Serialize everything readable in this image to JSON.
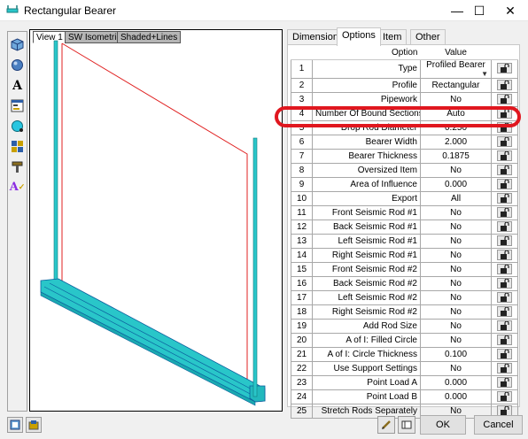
{
  "window": {
    "title": "Rectangular Bearer",
    "minimize": "—",
    "maximize": "☐",
    "close": "✕"
  },
  "view": {
    "tabs": [
      "View 1",
      "SW Isometric",
      "Shaded+Lines"
    ],
    "model_color": "#29c6c9",
    "outline_color": "#e02020"
  },
  "properties": {
    "tabs": [
      "Dimensions",
      "Options",
      "Item",
      "Other"
    ],
    "active_tab": "Options",
    "header_option": "Option",
    "header_value": "Value",
    "rows": [
      {
        "num": "1",
        "option": "Type",
        "value": "Profiled Bearer"
      },
      {
        "num": "2",
        "option": "Profile",
        "value": "Rectangular"
      },
      {
        "num": "3",
        "option": "Pipework",
        "value": "No"
      },
      {
        "num": "4",
        "option": "Number Of Bound Sections",
        "value": "Auto"
      },
      {
        "num": "5",
        "option": "Drop Rod Diameter",
        "value": "0.250"
      },
      {
        "num": "6",
        "option": "Bearer Width",
        "value": "2.000"
      },
      {
        "num": "7",
        "option": "Bearer Thickness",
        "value": "0.1875"
      },
      {
        "num": "8",
        "option": "Oversized Item",
        "value": "No"
      },
      {
        "num": "9",
        "option": "Area of Influence",
        "value": "0.000"
      },
      {
        "num": "10",
        "option": "Export",
        "value": "All"
      },
      {
        "num": "11",
        "option": "Front Seismic Rod #1",
        "value": "No"
      },
      {
        "num": "12",
        "option": "Back Seismic Rod #1",
        "value": "No"
      },
      {
        "num": "13",
        "option": "Left Seismic Rod #1",
        "value": "No"
      },
      {
        "num": "14",
        "option": "Right Seismic Rod #1",
        "value": "No"
      },
      {
        "num": "15",
        "option": "Front Seismic Rod #2",
        "value": "No"
      },
      {
        "num": "16",
        "option": "Back Seismic Rod #2",
        "value": "No"
      },
      {
        "num": "17",
        "option": "Left Seismic Rod #2",
        "value": "No"
      },
      {
        "num": "18",
        "option": "Right Seismic Rod #2",
        "value": "No"
      },
      {
        "num": "19",
        "option": "Add Rod Size",
        "value": "No"
      },
      {
        "num": "20",
        "option": "A of I: Filled Circle",
        "value": "No"
      },
      {
        "num": "21",
        "option": "A of I: Circle Thickness",
        "value": "0.100"
      },
      {
        "num": "22",
        "option": "Use Support Settings",
        "value": "No"
      },
      {
        "num": "23",
        "option": "Point Load A",
        "value": "0.000"
      },
      {
        "num": "24",
        "option": "Point Load B",
        "value": "0.000"
      },
      {
        "num": "25",
        "option": "Stretch Rods Separately",
        "value": "No"
      }
    ],
    "highlight_color": "#e0171f"
  },
  "toolbar_icons": [
    "cube-icon",
    "sphere-icon",
    "text-icon",
    "properties-icon",
    "circle-icon",
    "grid-icon",
    "hammer-icon",
    "text-style-icon"
  ],
  "footer": {
    "ok": "OK",
    "cancel": "Cancel"
  }
}
